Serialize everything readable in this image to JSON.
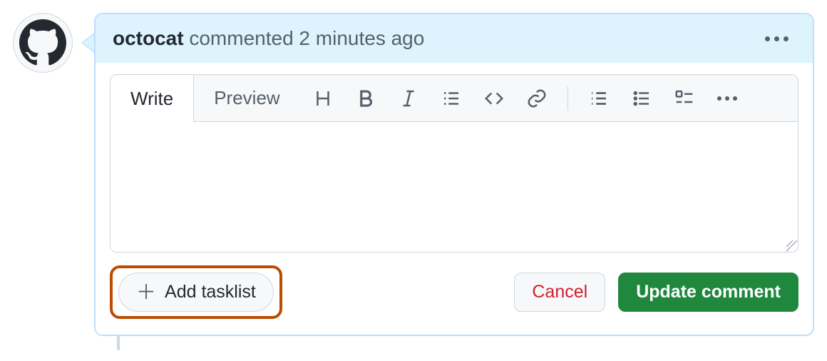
{
  "author": "octocat",
  "meta_suffix": " commented 2 minutes ago",
  "tabs": {
    "write": "Write",
    "preview": "Preview"
  },
  "comment_text": "",
  "buttons": {
    "add_tasklist": "Add tasklist",
    "cancel": "Cancel",
    "update": "Update comment"
  }
}
